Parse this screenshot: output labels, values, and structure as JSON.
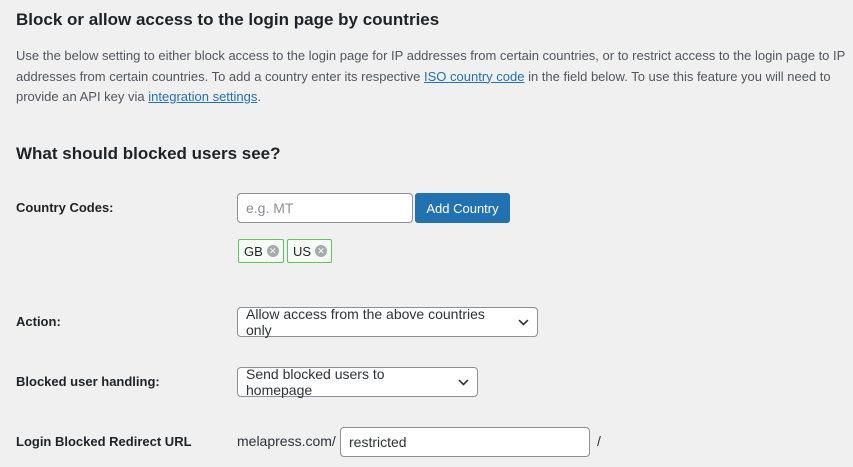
{
  "section": {
    "title": "Block or allow access to the login page by countries",
    "desc_part1": "Use the below setting to either block access to the login page for IP addresses from certain countries, or to restrict access to the login page to IP addresses from certain countries. To add a country enter its respective ",
    "desc_link1": "ISO country code",
    "desc_part2": " in the field below. To use this feature you will need to provide an API key via ",
    "desc_link2": "integration settings",
    "desc_part3": "."
  },
  "subtitle": "What should blocked users see?",
  "country_codes": {
    "label": "Country Codes:",
    "input_value": "",
    "placeholder": "e.g. MT",
    "add_button": "Add Country",
    "chips": [
      "GB",
      "US"
    ],
    "remove_icon": "remove-circle-icon"
  },
  "action": {
    "label": "Action:",
    "selected": "Allow access from the above countries only",
    "icon": "chevron-down-icon"
  },
  "blocked_handling": {
    "label": "Blocked user handling:",
    "selected": "Send blocked users to homepage",
    "icon": "chevron-down-icon"
  },
  "redirect": {
    "label": "Login Blocked Redirect URL",
    "prefix": "melapress.com/",
    "value": "restricted",
    "suffix": "/"
  },
  "colors": {
    "primary": "#2271b1",
    "chip_border": "#5ec25e",
    "background": "#f0f0f1"
  }
}
